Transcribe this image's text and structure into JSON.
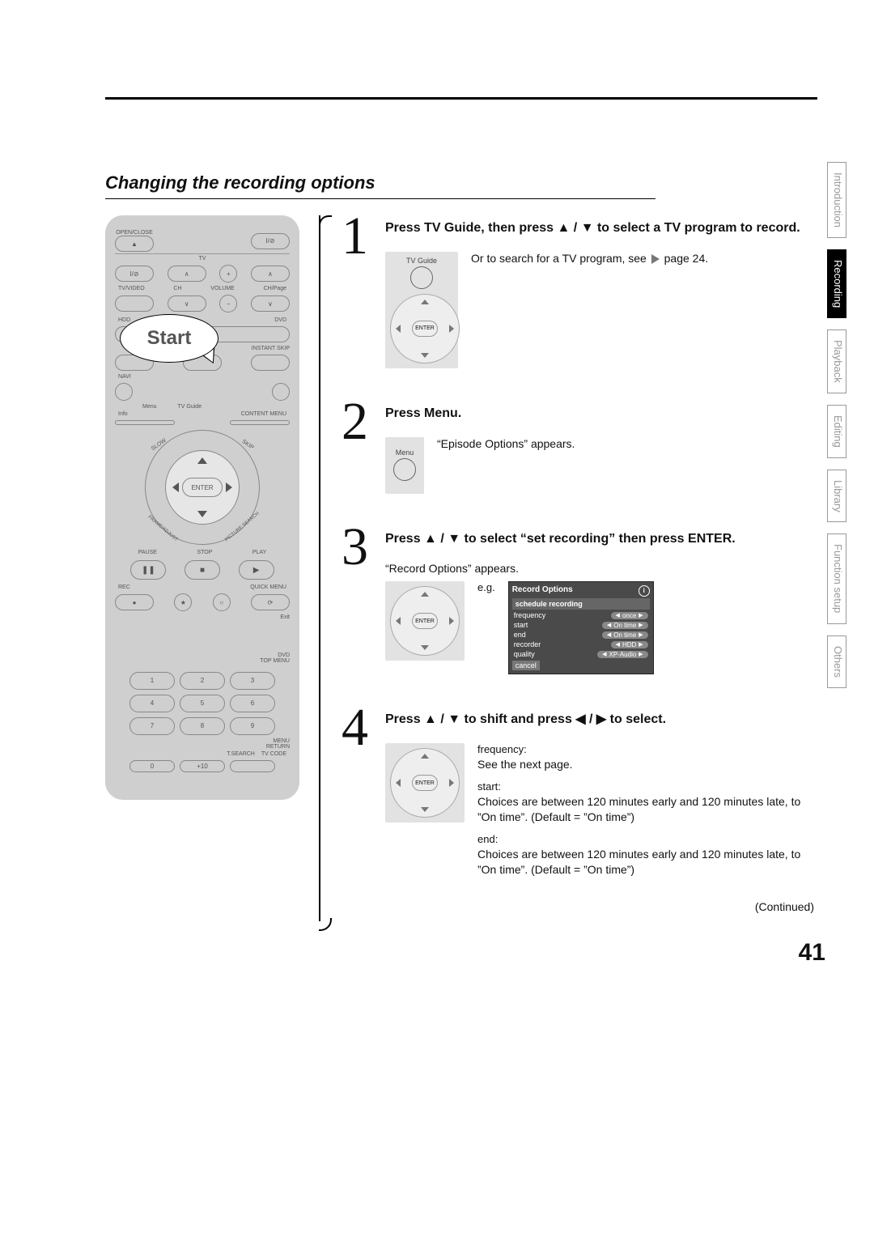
{
  "page_number": "41",
  "section_title": "Changing the recording options",
  "start_label": "Start",
  "continued": "(Continued)",
  "sidetabs": {
    "introduction": "Introduction",
    "recording": "Recording",
    "playback": "Playback",
    "editing": "Editing",
    "library": "Library",
    "function_setup": "Function setup",
    "others": "Others"
  },
  "remote": {
    "open_close": "OPEN/CLOSE",
    "power": "I/⊘",
    "tv": "TV",
    "tv_video": "TV/VIDEO",
    "ch": "CH",
    "volume": "VOLUME",
    "ch_page": "CH/Page",
    "hdd": "HDD",
    "dvd": "DVD",
    "instant_skip": "INSTANT SKIP",
    "navi": "NAVI",
    "menu": "Menu",
    "tv_guide": "TV Guide",
    "info": "Info",
    "content_menu": "CONTENT MENU",
    "slow": "SLOW",
    "skip": "SKIP",
    "frame_adjust": "FRAME/ADJUST",
    "picture_search": "PICTURE SEARCH",
    "enter": "ENTER",
    "pause": "PAUSE",
    "stop": "STOP",
    "play": "PLAY",
    "rec": "REC",
    "quick_menu": "QUICK MENU",
    "exit": "Exit",
    "dvd_top_menu": "DVD\nTOP MENU",
    "menu2": "MENU",
    "return": "RETURN",
    "t_search": "T.SEARCH",
    "tv_code": "TV CODE",
    "num0": "0",
    "num1": "1",
    "num2": "2",
    "num3": "3",
    "num4": "4",
    "num5": "5",
    "num6": "6",
    "num7": "7",
    "num8": "8",
    "num9": "9",
    "plus10": "+10"
  },
  "steps": [
    {
      "num": "1",
      "head": "Press TV Guide, then press ▲ / ▼ to select a TV program to record.",
      "btn_label": "TV Guide",
      "note": "Or to search for a TV program, see",
      "page_ref": "page 24."
    },
    {
      "num": "2",
      "head": "Press Menu.",
      "btn_label": "Menu",
      "note": "“Episode Options” appears."
    },
    {
      "num": "3",
      "head": "Press ▲ / ▼ to select “set recording” then press ENTER.",
      "note": "“Record Options” appears.",
      "eg": "e.g.",
      "osd": {
        "title": "Record Options",
        "subtitle": "schedule recording",
        "rows": [
          {
            "label": "frequency",
            "value": "once"
          },
          {
            "label": "start",
            "value": "On time"
          },
          {
            "label": "end",
            "value": "On time"
          },
          {
            "label": "recorder",
            "value": "HDD"
          },
          {
            "label": "quality",
            "value": "XP-Audio"
          }
        ],
        "cancel": "cancel"
      }
    },
    {
      "num": "4",
      "head": "Press ▲ / ▼ to shift and press ◀ / ▶ to select.",
      "freq_label": "frequency:",
      "freq_text": "See the next page.",
      "start_label": "start:",
      "start_text": "Choices are between 120 minutes early and 120 minutes late, to ”On time”. (Default = ”On time”)",
      "end_label": "end:",
      "end_text": "Choices are between 120 minutes early and 120 minutes late, to ”On time”. (Default = ”On time”)"
    }
  ]
}
